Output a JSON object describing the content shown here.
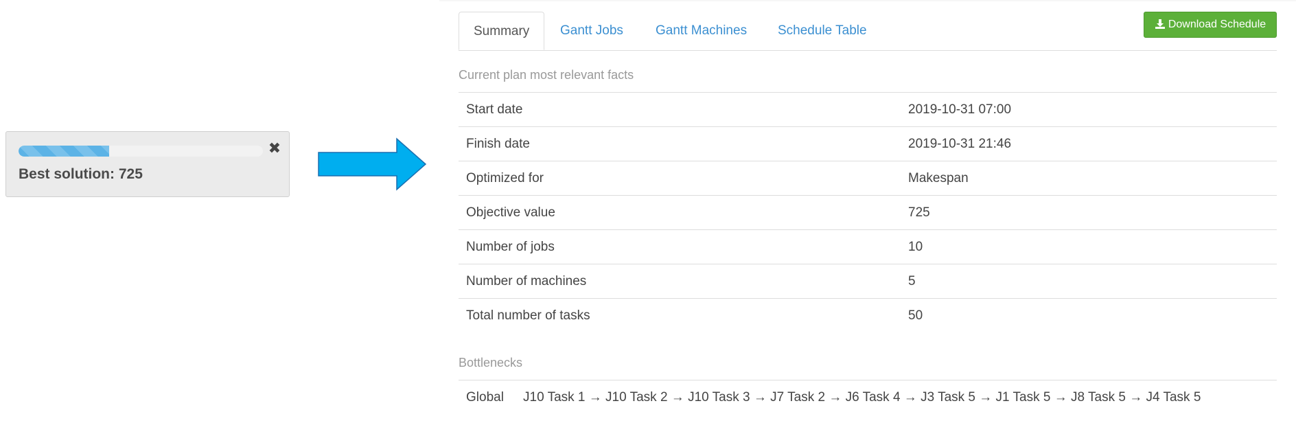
{
  "notification": {
    "progress": 0.37,
    "best_solution_text": "Best solution: 725",
    "close_glyph": "✖"
  },
  "tabs": [
    {
      "label": "Summary",
      "active": true
    },
    {
      "label": "Gantt Jobs",
      "active": false
    },
    {
      "label": "Gantt Machines",
      "active": false
    },
    {
      "label": "Schedule Table",
      "active": false
    }
  ],
  "toolbar": {
    "download_label": "Download Schedule"
  },
  "summary": {
    "heading": "Current plan most relevant facts",
    "facts": [
      {
        "label": "Start date",
        "value": "2019-10-31 07:00"
      },
      {
        "label": "Finish date",
        "value": "2019-10-31 21:46"
      },
      {
        "label": "Optimized for",
        "value": "Makespan"
      },
      {
        "label": "Objective value",
        "value": "725"
      },
      {
        "label": "Number of jobs",
        "value": "10"
      },
      {
        "label": "Number of machines",
        "value": "5"
      },
      {
        "label": "Total number of tasks",
        "value": "50"
      }
    ]
  },
  "bottlenecks": {
    "heading": "Bottlenecks",
    "global_label": "Global",
    "global_path": "J10 Task 1 → J10 Task 2 → J10 Task 3 → J7 Task 2 → J6 Task 4 → J3 Task 5 → J1 Task 5 → J8 Task 5 → J4 Task 5"
  },
  "colors": {
    "accent": "#3b8fd1",
    "progress": "#5cb3e6",
    "download_button": "#5cb039",
    "arrow": "#00aeef"
  },
  "icons": {
    "download": "download-icon",
    "close": "close-icon",
    "arrow": "arrow-right-icon"
  }
}
